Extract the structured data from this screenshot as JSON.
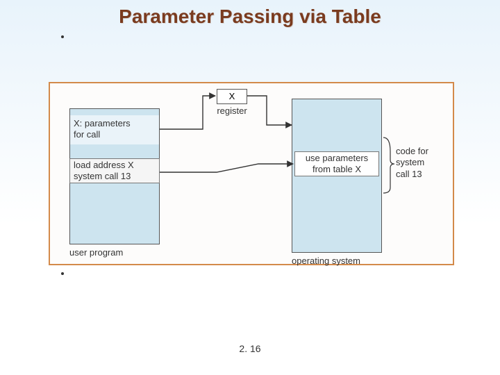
{
  "title": "Parameter Passing via Table",
  "page_number": "2. 16",
  "diagram": {
    "left_block": {
      "caption": "user program",
      "param_slot": "X: parameters\nfor call",
      "syscall_line": "load address X\nsystem call 13"
    },
    "register": {
      "value": "X",
      "label": "register"
    },
    "right_block": {
      "caption": "operating system",
      "use_params": "use parameters\nfrom table X",
      "code_for": "code for\nsystem\ncall 13"
    }
  }
}
